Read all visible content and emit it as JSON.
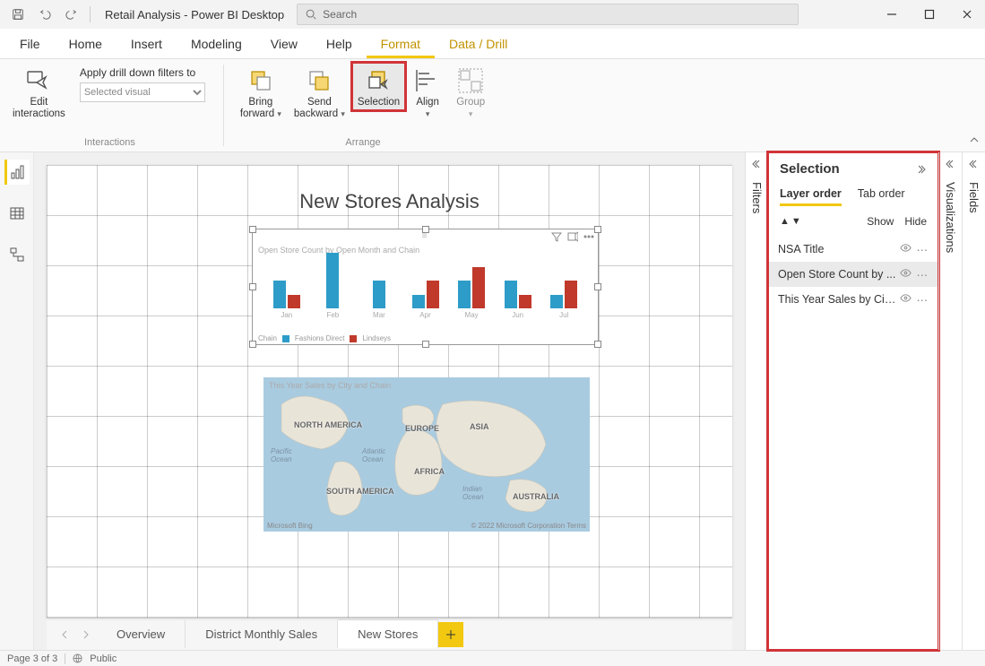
{
  "titlebar": {
    "title": "Retail Analysis - Power BI Desktop",
    "search_placeholder": "Search"
  },
  "menus": {
    "file": "File",
    "home": "Home",
    "insert": "Insert",
    "modeling": "Modeling",
    "view": "View",
    "help": "Help",
    "format": "Format",
    "datadrill": "Data / Drill"
  },
  "ribbon": {
    "edit_interactions": "Edit\ninteractions",
    "drilldown_label": "Apply drill down filters to",
    "drilldown_value": "Selected visual",
    "bring_forward": "Bring\nforward",
    "send_backward": "Send\nbackward",
    "selection": "Selection",
    "align": "Align",
    "group": "Group",
    "group_interactions": "Interactions",
    "group_arrange": "Arrange"
  },
  "report": {
    "title": "New Stores Analysis"
  },
  "chart_data": {
    "type": "bar",
    "title": "Open Store Count by Open Month and Chain",
    "xlabel": "",
    "ylabel": "",
    "legend_label": "Chain",
    "categories": [
      "Jan",
      "Feb",
      "Mar",
      "Apr",
      "May",
      "Jun",
      "Jul"
    ],
    "series": [
      {
        "name": "Fashions Direct",
        "color": "#2e9cc8",
        "values": [
          2,
          4,
          2,
          1,
          2,
          2,
          1
        ]
      },
      {
        "name": "Lindseys",
        "color": "#c0392b",
        "values": [
          1,
          0,
          0,
          2,
          3,
          1,
          2
        ]
      }
    ],
    "ylim": [
      0,
      4
    ]
  },
  "map": {
    "title": "This Year Sales by City and Chain",
    "labels": {
      "na": "NORTH AMERICA",
      "sa": "SOUTH AMERICA",
      "eu": "EUROPE",
      "af": "AFRICA",
      "as": "ASIA",
      "au": "AUSTRALIA"
    },
    "oceans": {
      "pac": "Pacific\nOcean",
      "atl": "Atlantic\nOcean",
      "ind": "Indian\nOcean"
    },
    "attr_left": "Microsoft Bing",
    "attr_right": "© 2022 Microsoft Corporation   Terms"
  },
  "pagetabs": {
    "overview": "Overview",
    "dms": "District Monthly Sales",
    "newstores": "New Stores"
  },
  "rails": {
    "filters": "Filters",
    "viz": "Visualizations",
    "fields": "Fields"
  },
  "selection": {
    "title": "Selection",
    "layer": "Layer order",
    "tab": "Tab order",
    "show": "Show",
    "hide": "Hide",
    "items": [
      {
        "name": "NSA Title"
      },
      {
        "name": "Open Store Count by ..."
      },
      {
        "name": "This Year Sales by City..."
      }
    ]
  },
  "status": {
    "page": "Page 3 of 3",
    "public": "Public"
  }
}
